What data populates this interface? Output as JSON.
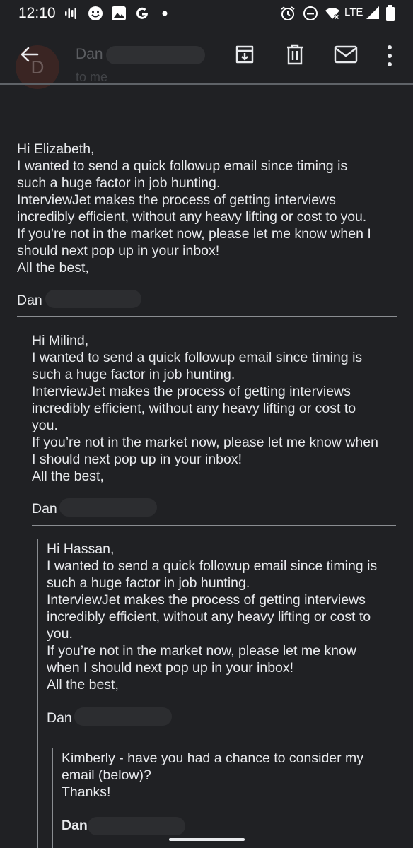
{
  "status_bar": {
    "time": "12:10",
    "network": "LTE"
  },
  "header": {
    "avatar_letter": "D",
    "sender": "Dan",
    "recipient_label": "to me"
  },
  "message": {
    "lines": [
      "Hi Elizabeth,",
      "I wanted to send a quick followup email since timing is",
      "such a huge factor in job hunting.",
      "InterviewJet makes the process of getting interviews",
      "incredibly efficient, without any heavy lifting or cost to you.",
      "If you’re not in the market now, please let me know when I",
      "should next pop up in your inbox!",
      "All the best,"
    ],
    "signature": "Dan"
  },
  "quote1": {
    "lines": [
      "Hi Milind,",
      "I wanted to send a quick followup email since timing is",
      "such a huge factor in job hunting.",
      "InterviewJet makes the process of getting interviews",
      "incredibly efficient, without any heavy lifting or cost to",
      "you.",
      "If you’re not in the market now, please let me know when",
      "I should next pop up in your inbox!",
      "All the best,"
    ],
    "signature": "Dan"
  },
  "quote2": {
    "lines": [
      "Hi Hassan,",
      "I wanted to send a quick followup email since timing is",
      "such a huge factor in job hunting.",
      "InterviewJet makes the process of getting interviews",
      "incredibly efficient, without any heavy lifting or cost to",
      "you.",
      "If you’re not in the market now, please let me know",
      "when I should next pop up in your inbox!",
      "All the best,"
    ],
    "signature": "Dan"
  },
  "quote3": {
    "lines": [
      "Kimberly - have you had a chance to consider my",
      "email (below)?",
      "Thanks!"
    ],
    "signature": "Dan"
  },
  "icons": [
    "back-arrow-icon",
    "archive-icon",
    "delete-icon",
    "mark-unread-icon",
    "more-vert-icon"
  ]
}
